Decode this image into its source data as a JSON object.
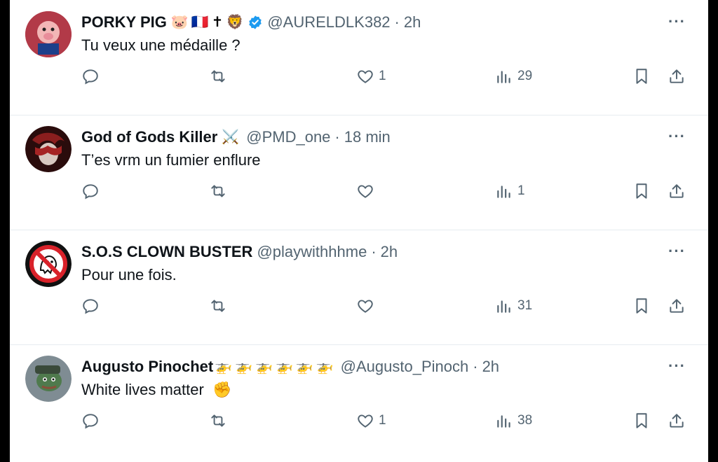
{
  "tweets": [
    {
      "name": "PORKY PIG",
      "emojis": [
        "🐷",
        "🇫🇷",
        "✝",
        "🦁"
      ],
      "verified": true,
      "handle": "@AURELDLK382",
      "time": "2h",
      "text": "Tu veux une médaille ?",
      "likes": "1",
      "views": "29",
      "avatar_color": "#b23a48"
    },
    {
      "name": "God of Gods Killer",
      "emojis": [
        "⚔️"
      ],
      "verified": false,
      "handle": "@PMD_one",
      "time": "18 min",
      "text": "T’es vrm un fumier enflure",
      "likes": "",
      "views": "1",
      "avatar_color": "#5a1a1a"
    },
    {
      "name": "S.O.S CLOWN BUSTER",
      "emojis": [],
      "verified": false,
      "handle": "@playwithhhme",
      "time": "2h",
      "text": "Pour une fois.",
      "likes": "",
      "views": "31",
      "avatar_color": "#111111"
    },
    {
      "name": "Augusto Pinochet",
      "emojis": [
        "🚁",
        "🚁",
        "🚁",
        "🚁",
        "🚁",
        "🚁"
      ],
      "verified": false,
      "handle": "@Augusto_Pinoch",
      "time": "2h",
      "text": "White lives matter",
      "text_emoji": "✊",
      "likes": "1",
      "views": "38",
      "avatar_color": "#4d6a55"
    }
  ],
  "ui": {
    "more": "···",
    "separator": "·"
  },
  "icons": [
    "reply-icon",
    "retweet-icon",
    "heart-icon",
    "views-icon",
    "bookmark-icon",
    "share-icon",
    "verified-badge-icon",
    "more-icon"
  ],
  "colors": {
    "text": "#0f1419",
    "secondary": "#536471",
    "verified": "#1d9bf0",
    "border": "#e6ecf0"
  }
}
